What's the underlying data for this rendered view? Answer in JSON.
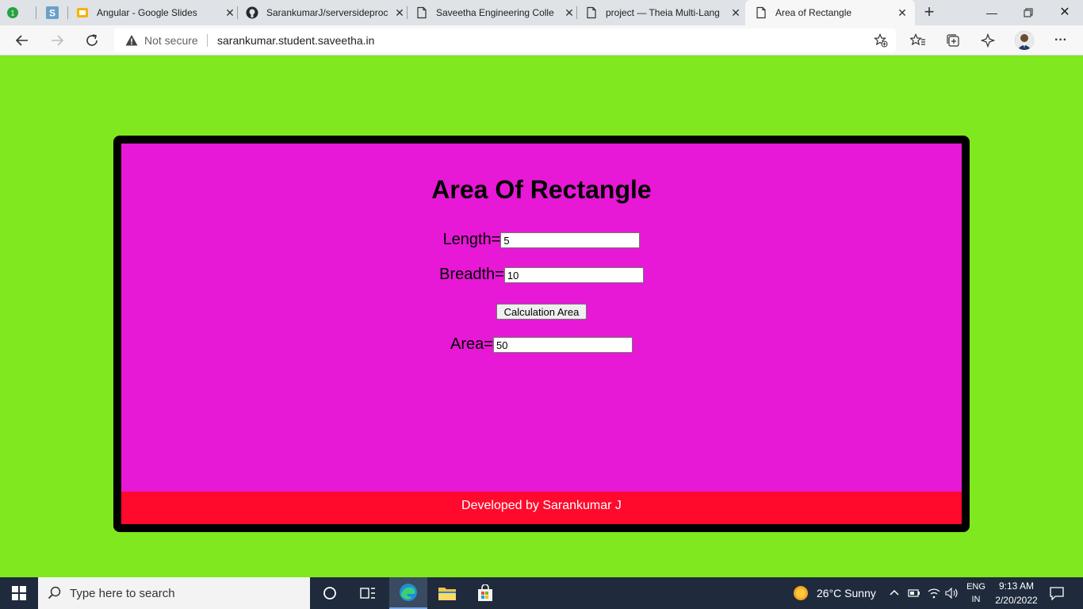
{
  "browser": {
    "tabs": [
      {
        "title": "",
        "icon": "whatsapp-badge-icon"
      },
      {
        "title": "",
        "icon": "s-app-icon"
      },
      {
        "title": "Angular - Google Slides",
        "icon": "google-slides-icon"
      },
      {
        "title": "SarankumarJ/serversideproc",
        "icon": "github-icon"
      },
      {
        "title": "Saveetha Engineering Colle",
        "icon": "page-icon"
      },
      {
        "title": "project — Theia Multi-Lang",
        "icon": "page-icon"
      },
      {
        "title": "Area of Rectangle",
        "icon": "page-icon"
      }
    ],
    "active_tab": "Area of Rectangle",
    "address_bar": {
      "security_label": "Not secure",
      "url": "sarankumar.student.saveetha.in"
    }
  },
  "page": {
    "heading": "Area Of Rectangle",
    "length_label": "Length=",
    "length_value": "5",
    "breadth_label": "Breadth=",
    "breadth_value": "10",
    "calc_button": "Calculation Area",
    "area_label": "Area=",
    "area_value": "50",
    "footer": "Developed by Sarankumar J"
  },
  "colors": {
    "page_background": "#7fe81e",
    "panel_background": "#e718d6",
    "footer_background": "#ff0a2c"
  },
  "taskbar": {
    "search_placeholder": "Type here to search",
    "weather": "26°C  Sunny",
    "language": [
      "ENG",
      "IN"
    ],
    "time": "9:13 AM",
    "date": "2/20/2022"
  }
}
